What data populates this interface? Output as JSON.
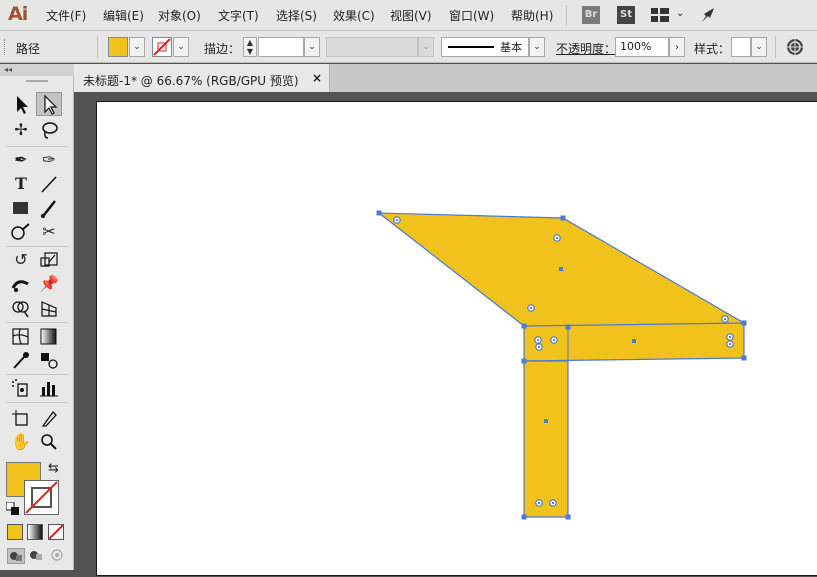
{
  "app": {
    "logo": "Ai"
  },
  "menu": {
    "items": [
      "文件(F)",
      "编辑(E)",
      "对象(O)",
      "文字(T)",
      "选择(S)",
      "效果(C)",
      "视图(V)",
      "窗口(W)",
      "帮助(H)"
    ],
    "bridge_label": "Br",
    "stock_label": "St",
    "workspace_icon": "grid-layout-icon",
    "publish_icon": "rocket-icon"
  },
  "control_bar": {
    "selection_type": "路径",
    "fill_color": "#f1c21b",
    "stroke_label": "描边：",
    "stroke_weight": "",
    "profile": "",
    "brush_label": "基本",
    "opacity_label": "不透明度：",
    "opacity_value": "100%",
    "style_label": "样式："
  },
  "document": {
    "tab_title": "未标题-1* @ 66.67% (RGB/GPU 预览)",
    "close_glyph": "×"
  },
  "toolbox": {
    "collapse_glyph": "◂◂",
    "fill_color": "#f1c21b",
    "stroke_color": "none"
  },
  "artwork": {
    "fill_color": "#f1c21b",
    "selection_color": "#4a7bd6"
  }
}
